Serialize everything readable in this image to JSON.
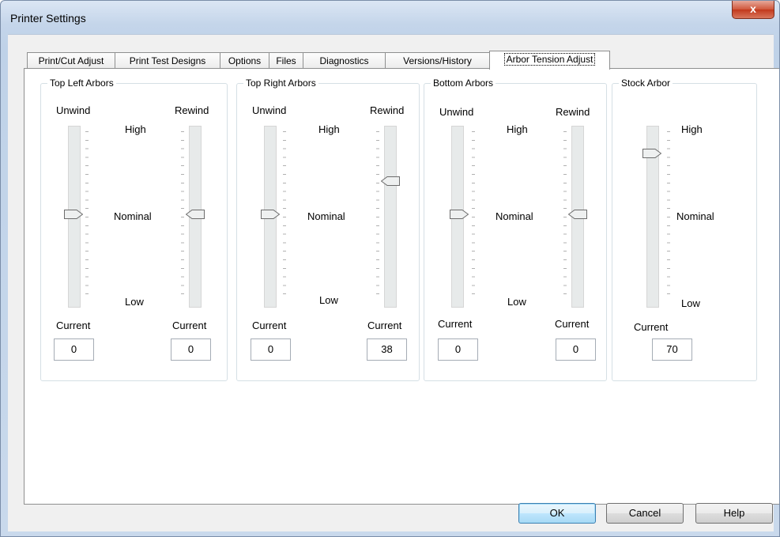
{
  "window": {
    "title": "Printer Settings",
    "close_glyph": "x"
  },
  "tabs": [
    {
      "label": "Print/Cut Adjust",
      "active": false
    },
    {
      "label": "Print Test Designs",
      "active": false
    },
    {
      "label": "Options",
      "active": false
    },
    {
      "label": "Files",
      "active": false
    },
    {
      "label": "Diagnostics",
      "active": false
    },
    {
      "label": "Versions/History",
      "active": false
    },
    {
      "label": "Arbor Tension Adjust",
      "active": true
    }
  ],
  "groups": {
    "top_left": {
      "title": "Top Left Arbors",
      "unwind": {
        "label": "Unwind",
        "current_label": "Current",
        "current": "0",
        "level": 0
      },
      "rewind": {
        "label": "Rewind",
        "current_label": "Current",
        "current": "0",
        "level": 0
      },
      "scale": {
        "high": "High",
        "nominal": "Nominal",
        "low": "Low"
      }
    },
    "top_right": {
      "title": "Top Right Arbors",
      "unwind": {
        "label": "Unwind",
        "current_label": "Current",
        "current": "0",
        "level": 0
      },
      "rewind": {
        "label": "Rewind",
        "current_label": "Current",
        "current": "38",
        "level": 38
      },
      "scale": {
        "high": "High",
        "nominal": "Nominal",
        "low": "Low"
      }
    },
    "bottom": {
      "title": "Bottom Arbors",
      "unwind": {
        "label": "Unwind",
        "current_label": "Current",
        "current": "0",
        "level": 0
      },
      "rewind": {
        "label": "Rewind",
        "current_label": "Current",
        "current": "0",
        "level": 0
      },
      "scale": {
        "high": "High",
        "nominal": "Nominal",
        "low": "Low"
      }
    },
    "stock": {
      "title": "Stock Arbor",
      "stock": {
        "current_label": "Current",
        "current": "70",
        "level": 70
      },
      "scale": {
        "high": "High",
        "nominal": "Nominal",
        "low": "Low"
      }
    }
  },
  "slider_range": {
    "min": -100,
    "max": 100
  },
  "buttons": {
    "ok": "OK",
    "cancel": "Cancel",
    "help": "Help"
  }
}
